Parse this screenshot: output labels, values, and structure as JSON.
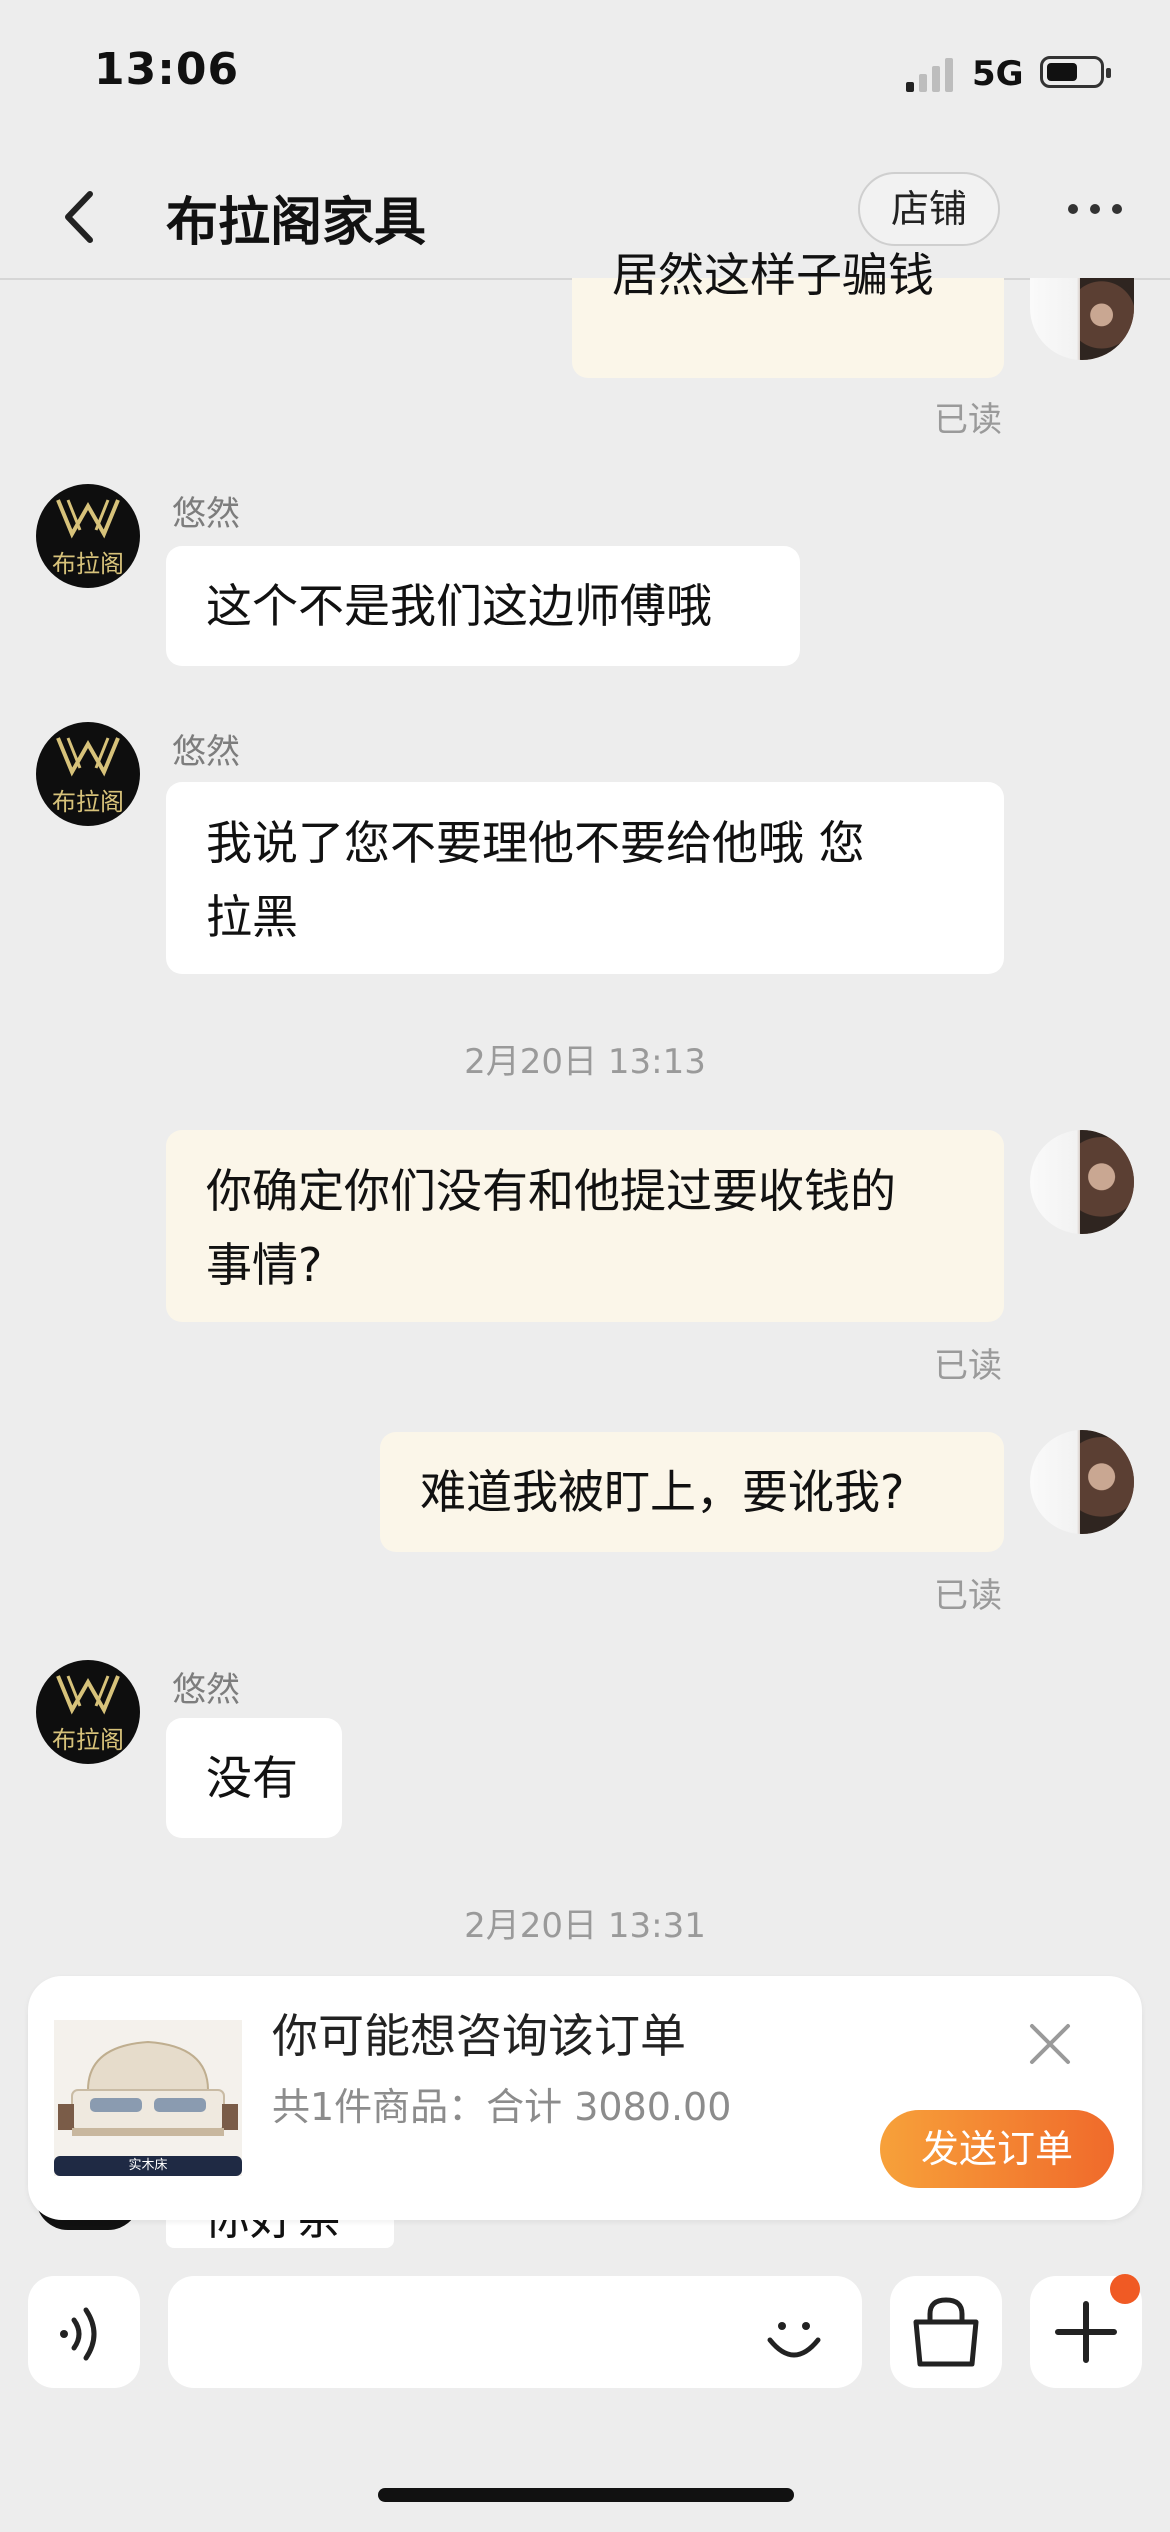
{
  "status_bar": {
    "time": "13:06",
    "network": "5G"
  },
  "header": {
    "title": "布拉阁家具",
    "shop_button": "店铺"
  },
  "avatars": {
    "shop_brand_text": "布拉阁"
  },
  "messages": {
    "m1": {
      "text": "居然这样子骗钱",
      "read": "已读"
    },
    "m2": {
      "sender": "悠然",
      "text": "这个不是我们这边师傅哦"
    },
    "m3": {
      "sender": "悠然",
      "line1": "我说了您不要理他不要给他哦 您",
      "line2": "拉黑"
    },
    "ts1": "2月20日 13:13",
    "m4": {
      "line1": "你确定你们没有和他提过要收钱的",
      "line2": "事情?",
      "read": "已读"
    },
    "m5": {
      "text": "难道我被盯上，要讹我?",
      "read": "已读"
    },
    "m6": {
      "sender": "悠然",
      "text": "没有"
    },
    "ts2": "2月20日 13:31",
    "peek": "你好亲"
  },
  "order_card": {
    "title": "你可能想咨询该订单",
    "subtitle": "共1件商品：合计 3080.00",
    "send_button": "发送订单",
    "thumb_label": "实木床"
  },
  "input_bar": {
    "placeholder": ""
  },
  "colors": {
    "accent": "#f06a2b",
    "bubble_mine": "#fbf6e9",
    "background": "#ededed"
  },
  "icons": [
    "back-chevron-icon",
    "more-icon",
    "voice-icon",
    "emoji-icon",
    "bag-icon",
    "plus-icon",
    "close-icon"
  ]
}
